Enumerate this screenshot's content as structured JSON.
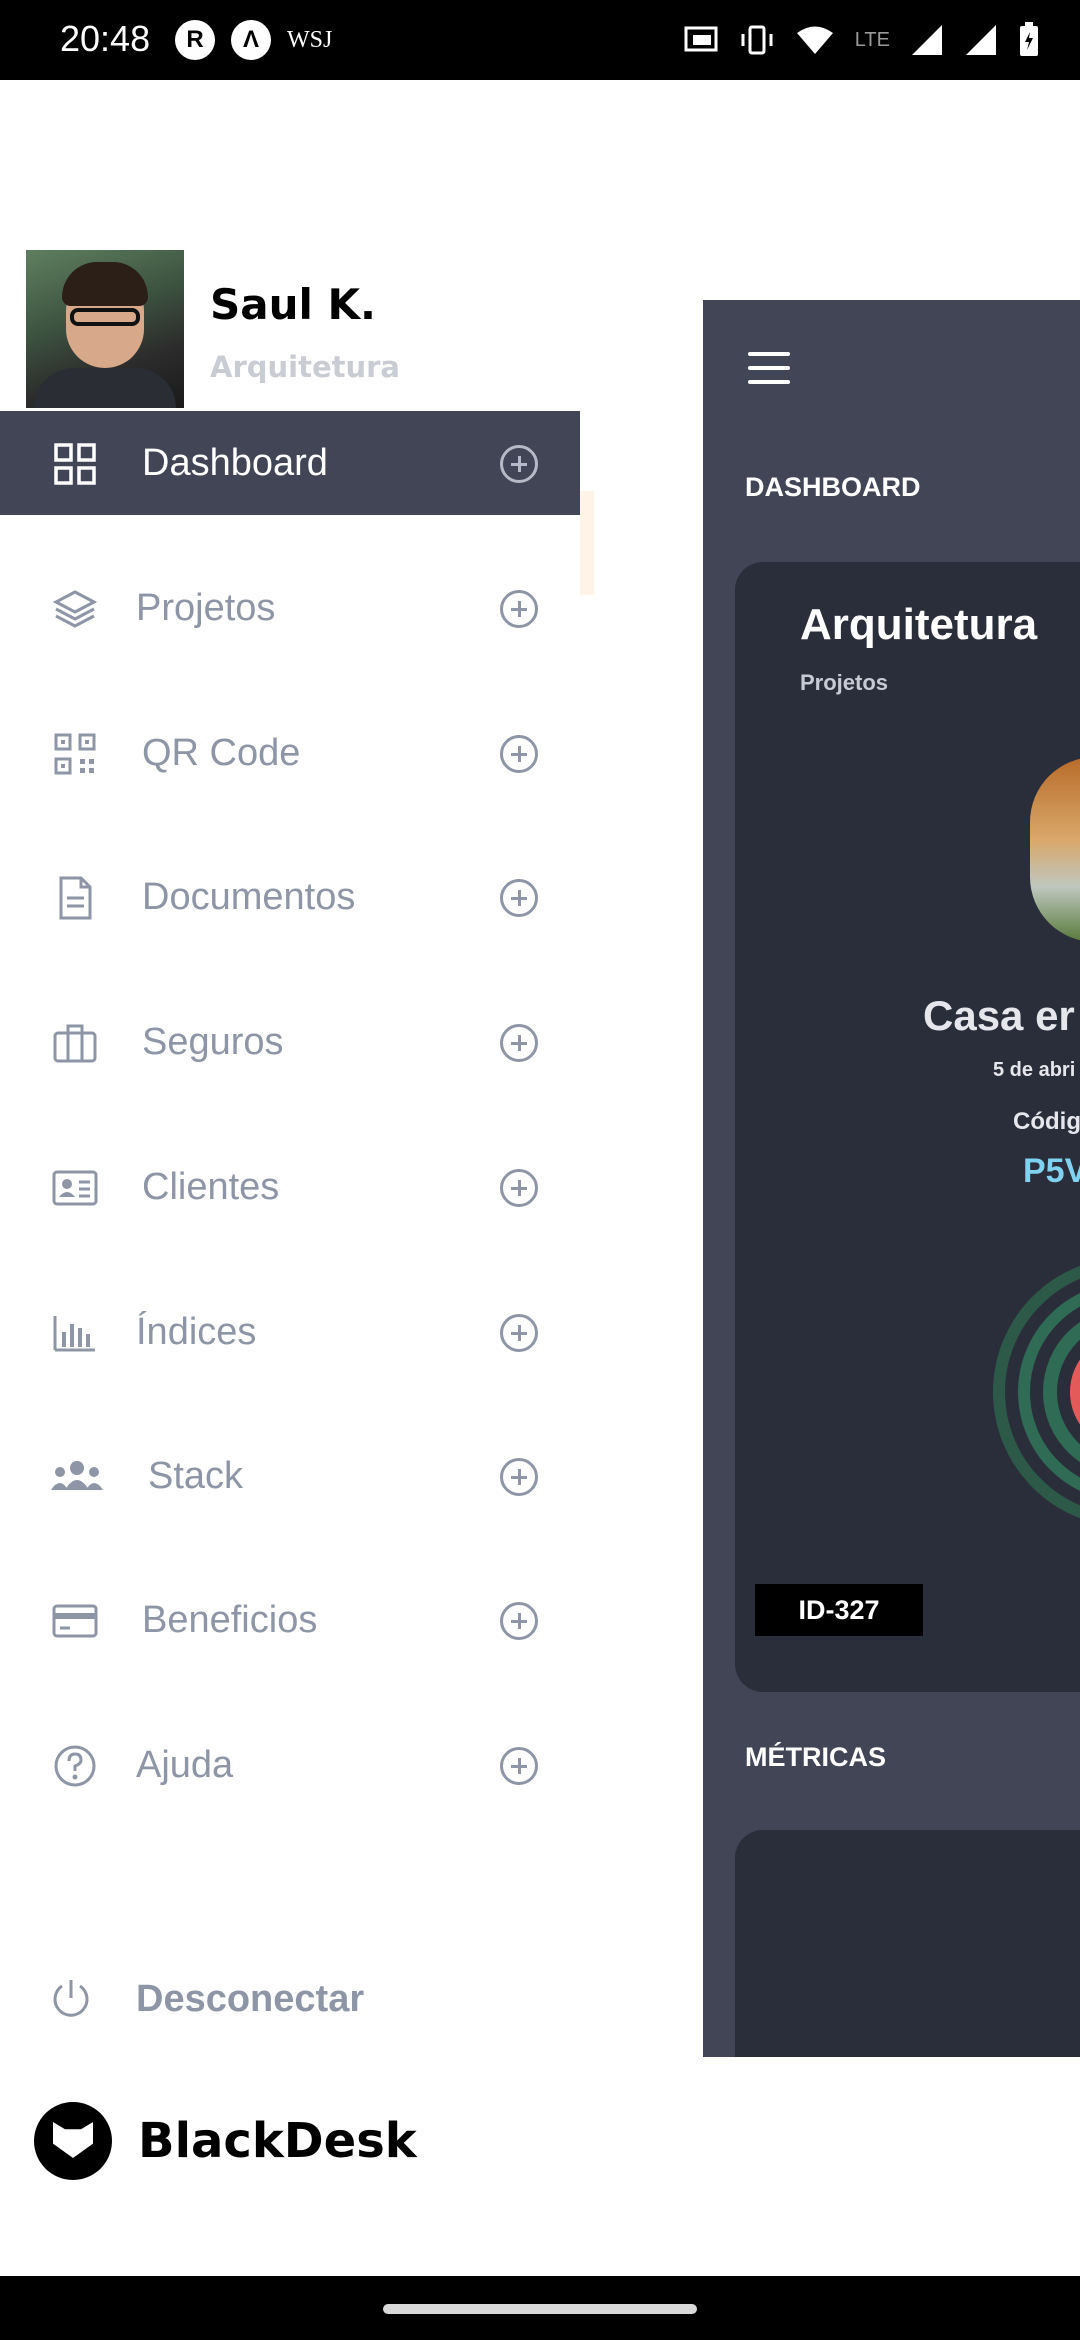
{
  "status_bar": {
    "time": "20:48",
    "left_icons": [
      "r-app-icon",
      "caret-app-icon"
    ],
    "wsj": "WSJ",
    "network_label": "LTE",
    "right_icons": [
      "cast-icon",
      "vibrate-icon",
      "wifi-icon",
      "signal-icon",
      "signal-icon",
      "battery-icon"
    ]
  },
  "profile": {
    "name": "Saul K.",
    "role": "Arquitetura"
  },
  "menu": {
    "items": [
      {
        "label": "Dashboard",
        "icon": "grid-icon",
        "active": true
      },
      {
        "label": "Projetos",
        "icon": "layers-icon"
      },
      {
        "label": "QR Code",
        "icon": "qr-code-icon"
      },
      {
        "label": "Documentos",
        "icon": "document-icon"
      },
      {
        "label": "Seguros",
        "icon": "briefcase-icon"
      },
      {
        "label": "Clientes",
        "icon": "id-card-icon"
      },
      {
        "label": "Índices",
        "icon": "bar-chart-icon"
      },
      {
        "label": "Stack",
        "icon": "users-icon"
      },
      {
        "label": "Beneficios",
        "icon": "credit-card-icon"
      },
      {
        "label": "Ajuda",
        "icon": "help-icon"
      }
    ],
    "logout_label": "Desconectar"
  },
  "brand": {
    "name": "BlackDesk"
  },
  "dashboard": {
    "heading": "DASHBOARD",
    "card": {
      "title": "Arquitetura",
      "subtitle": "Projetos",
      "project_name": "Casa er",
      "date": "5 de abri",
      "code_label": "Códig",
      "code": "P5V",
      "id_badge": "ID-327"
    },
    "metrics_heading": "MÉTRICAS"
  },
  "colors": {
    "panel": "#414556",
    "card": "#2a2d3a",
    "menu_text": "#8d95a6",
    "accent_code": "#7fd3f0"
  }
}
